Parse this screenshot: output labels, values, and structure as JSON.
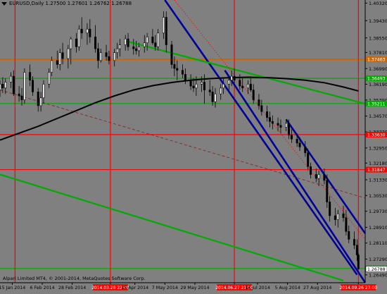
{
  "header": {
    "symbol": "EURUSD,Daily",
    "open": "1.27500",
    "high": "1.27601",
    "low": "1.26762",
    "close": "1.26788"
  },
  "footer": {
    "copyright": "Alpari Limited MT4, © 2001-2014, MetaQuotes Software Corp."
  },
  "colors": {
    "background": "#808080",
    "candle": "#000000",
    "moving_average": "#000000",
    "channel": "#000099",
    "green_lines": "#00aa00",
    "red_lines": "#ff0000",
    "orange_line": "#cc6600",
    "dashed_line": "#8b1a1a",
    "red_label": "#ff0000"
  },
  "chart_data": {
    "type": "candlestick",
    "symbol": "EURUSD",
    "timeframe": "Daily",
    "ylim": [
      1.2609,
      1.4048
    ],
    "y_ticks": [
      "1.40320",
      "1.39430",
      "1.38550",
      "1.37810",
      "1.36990",
      "1.36190",
      "1.35390",
      "1.34570",
      "1.33770",
      "1.32950",
      "1.32180",
      "1.31330",
      "1.30530",
      "1.29730",
      "1.28910",
      "1.28110",
      "1.27290",
      "1.26490"
    ],
    "x_ticks": [
      {
        "label": "15 Jan 2014",
        "date": "2014-01-15"
      },
      {
        "label": "6 Feb 2014",
        "date": "2014-02-06"
      },
      {
        "label": "28 Feb 2014",
        "date": "2014-02-28"
      },
      {
        "label": "2014.03.28 22:00",
        "date": "2014-03-28",
        "highlight": true
      },
      {
        "label": "15 Apr 2014",
        "date": "2014-04-15"
      },
      {
        "label": "7 May 2014",
        "date": "2014-05-07"
      },
      {
        "label": "29 May 2014",
        "date": "2014-05-29"
      },
      {
        "label": "2014.06.27 21:00",
        "date": "2014-06-27",
        "highlight": true
      },
      {
        "label": "14 Jul 2014",
        "date": "2014-07-14"
      },
      {
        "label": "5 Aug 2014",
        "date": "2014-08-05"
      },
      {
        "label": "27 Aug 2014",
        "date": "2014-08-27"
      },
      {
        "label": "2014.09.26 23:00",
        "date": "2014-09-26",
        "highlight": true
      }
    ],
    "price_levels": [
      {
        "label": "1.37463",
        "value": 1.37463,
        "color": "#cc6600"
      },
      {
        "label": "1.36493",
        "value": 1.36493,
        "color": "#00aa00"
      },
      {
        "label": "1.35211",
        "value": 1.35211,
        "color": "#00aa00"
      },
      {
        "label": "1.33630",
        "value": 1.3363,
        "color": "#ff0000"
      },
      {
        "label": "1.31847",
        "value": 1.31847,
        "color": "#ff0000"
      },
      {
        "label": "1.26815",
        "value": 1.26815,
        "color": "#00aa00"
      }
    ],
    "vertical_lines": [
      {
        "date": "2014-01-17",
        "color": "#ff0000"
      },
      {
        "date": "2014-03-28",
        "color": "#ff0000"
      },
      {
        "date": "2014-06-27",
        "color": "#ff0000"
      },
      {
        "date": "2014-09-26",
        "color": "#ff0000"
      }
    ],
    "trendlines": [
      {
        "kind": "channel",
        "color": "#000099",
        "points": [
          [
            "2014-05-07",
            1.4048
          ],
          [
            "2014-09-25",
            1.265
          ]
        ]
      },
      {
        "kind": "channel",
        "color": "#000099",
        "points": [
          [
            "2014-06-20",
            1.369
          ],
          [
            "2014-10-01",
            1.261
          ]
        ]
      },
      {
        "kind": "channel",
        "color": "#000099",
        "points": [
          [
            "2014-08-04",
            1.344
          ],
          [
            "2014-10-01",
            1.286
          ]
        ]
      },
      {
        "kind": "resistance",
        "color": "#00aa00",
        "points": [
          [
            "2014-04-08",
            1.384
          ],
          [
            "2014-10-01",
            1.352
          ]
        ]
      },
      {
        "kind": "support",
        "color": "#00aa00",
        "points": [
          [
            "2014-01-06",
            1.316
          ],
          [
            "2014-09-15",
            1.262
          ]
        ]
      },
      {
        "kind": "dashed",
        "color": "#8b1a1a",
        "points": [
          [
            "2014-01-06",
            1.359
          ],
          [
            "2014-10-01",
            1.304
          ]
        ]
      },
      {
        "kind": "dotted",
        "color": "#ff0000",
        "points": [
          [
            "2014-05-14",
            1.4048
          ],
          [
            "2014-10-01",
            1.283
          ]
        ]
      }
    ],
    "moving_average": [
      [
        "2014-01-06",
        1.3335
      ],
      [
        "2014-01-20",
        1.337
      ],
      [
        "2014-02-03",
        1.3405
      ],
      [
        "2014-02-17",
        1.3445
      ],
      [
        "2014-03-03",
        1.3485
      ],
      [
        "2014-03-17",
        1.3525
      ],
      [
        "2014-03-31",
        1.356
      ],
      [
        "2014-04-14",
        1.359
      ],
      [
        "2014-04-28",
        1.3612
      ],
      [
        "2014-05-12",
        1.3628
      ],
      [
        "2014-05-26",
        1.364
      ],
      [
        "2014-06-09",
        1.3648
      ],
      [
        "2014-06-23",
        1.3653
      ],
      [
        "2014-07-07",
        1.3655
      ],
      [
        "2014-07-21",
        1.3653
      ],
      [
        "2014-08-04",
        1.3648
      ],
      [
        "2014-08-18",
        1.364
      ],
      [
        "2014-09-01",
        1.3627
      ],
      [
        "2014-09-15",
        1.3605
      ],
      [
        "2014-09-26",
        1.3585
      ]
    ],
    "candles": [
      [
        "2014-01-06",
        1.359,
        1.364,
        1.3555,
        1.362
      ],
      [
        "2014-01-08",
        1.362,
        1.3655,
        1.3575,
        1.36
      ],
      [
        "2014-01-10",
        1.36,
        1.365,
        1.357,
        1.363
      ],
      [
        "2014-01-14",
        1.363,
        1.368,
        1.36,
        1.366
      ],
      [
        "2014-01-16",
        1.366,
        1.369,
        1.356,
        1.357
      ],
      [
        "2014-01-20",
        1.357,
        1.361,
        1.353,
        1.356
      ],
      [
        "2014-01-22",
        1.356,
        1.36,
        1.351,
        1.354
      ],
      [
        "2014-01-24",
        1.354,
        1.37,
        1.352,
        1.368
      ],
      [
        "2014-01-28",
        1.368,
        1.372,
        1.361,
        1.364
      ],
      [
        "2014-01-30",
        1.364,
        1.366,
        1.356,
        1.358
      ],
      [
        "2014-02-03",
        1.358,
        1.36,
        1.348,
        1.351
      ],
      [
        "2014-02-05",
        1.351,
        1.358,
        1.348,
        1.355
      ],
      [
        "2014-02-07",
        1.355,
        1.364,
        1.352,
        1.362
      ],
      [
        "2014-02-11",
        1.362,
        1.37,
        1.36,
        1.368
      ],
      [
        "2014-02-13",
        1.368,
        1.376,
        1.366,
        1.374
      ],
      [
        "2014-02-17",
        1.374,
        1.379,
        1.37,
        1.372
      ],
      [
        "2014-02-19",
        1.372,
        1.38,
        1.369,
        1.378
      ],
      [
        "2014-02-21",
        1.378,
        1.383,
        1.372,
        1.375
      ],
      [
        "2014-02-25",
        1.375,
        1.382,
        1.37,
        1.38
      ],
      [
        "2014-02-27",
        1.38,
        1.386,
        1.372,
        1.385
      ],
      [
        "2014-03-03",
        1.385,
        1.388,
        1.378,
        1.381
      ],
      [
        "2014-03-05",
        1.381,
        1.392,
        1.379,
        1.39
      ],
      [
        "2014-03-07",
        1.39,
        1.396,
        1.385,
        1.388
      ],
      [
        "2014-03-11",
        1.388,
        1.393,
        1.382,
        1.39
      ],
      [
        "2014-03-13",
        1.39,
        1.395,
        1.383,
        1.386
      ],
      [
        "2014-03-17",
        1.386,
        1.392,
        1.378,
        1.38
      ],
      [
        "2014-03-19",
        1.38,
        1.383,
        1.37,
        1.374
      ],
      [
        "2014-03-21",
        1.374,
        1.38,
        1.373,
        1.378
      ],
      [
        "2014-03-25",
        1.378,
        1.382,
        1.374,
        1.376
      ],
      [
        "2014-03-27",
        1.376,
        1.379,
        1.372,
        1.374
      ],
      [
        "2014-03-31",
        1.374,
        1.38,
        1.371,
        1.378
      ],
      [
        "2014-04-02",
        1.378,
        1.383,
        1.375,
        1.38
      ],
      [
        "2014-04-04",
        1.38,
        1.385,
        1.376,
        1.382
      ],
      [
        "2014-04-08",
        1.382,
        1.387,
        1.379,
        1.385
      ],
      [
        "2014-04-10",
        1.385,
        1.388,
        1.379,
        1.381
      ],
      [
        "2014-04-14",
        1.381,
        1.385,
        1.377,
        1.38
      ],
      [
        "2014-04-16",
        1.38,
        1.384,
        1.377,
        1.379
      ],
      [
        "2014-04-18",
        1.379,
        1.383,
        1.376,
        1.381
      ],
      [
        "2014-04-22",
        1.381,
        1.387,
        1.378,
        1.383
      ],
      [
        "2014-04-24",
        1.383,
        1.388,
        1.379,
        1.386
      ],
      [
        "2014-04-28",
        1.386,
        1.39,
        1.382,
        1.383
      ],
      [
        "2014-04-30",
        1.383,
        1.387,
        1.379,
        1.381
      ],
      [
        "2014-05-02",
        1.381,
        1.39,
        1.379,
        1.388
      ],
      [
        "2014-05-06",
        1.388,
        1.399,
        1.385,
        1.396
      ],
      [
        "2014-05-08",
        1.396,
        1.399,
        1.378,
        1.382
      ],
      [
        "2014-05-12",
        1.382,
        1.384,
        1.37,
        1.372
      ],
      [
        "2014-05-14",
        1.372,
        1.376,
        1.366,
        1.37
      ],
      [
        "2014-05-16",
        1.37,
        1.374,
        1.364,
        1.369
      ],
      [
        "2014-05-20",
        1.369,
        1.372,
        1.365,
        1.367
      ],
      [
        "2014-05-22",
        1.367,
        1.37,
        1.362,
        1.364
      ],
      [
        "2014-05-26",
        1.364,
        1.367,
        1.359,
        1.361
      ],
      [
        "2014-05-28",
        1.361,
        1.365,
        1.358,
        1.36
      ],
      [
        "2014-05-30",
        1.36,
        1.366,
        1.356,
        1.362
      ],
      [
        "2014-06-03",
        1.362,
        1.366,
        1.358,
        1.363
      ],
      [
        "2014-06-05",
        1.363,
        1.367,
        1.352,
        1.359
      ],
      [
        "2014-06-09",
        1.359,
        1.364,
        1.356,
        1.358
      ],
      [
        "2014-06-11",
        1.358,
        1.361,
        1.351,
        1.353
      ],
      [
        "2014-06-13",
        1.353,
        1.36,
        1.35,
        1.357
      ],
      [
        "2014-06-17",
        1.357,
        1.362,
        1.354,
        1.36
      ],
      [
        "2014-06-19",
        1.36,
        1.365,
        1.357,
        1.362
      ],
      [
        "2014-06-23",
        1.362,
        1.366,
        1.359,
        1.364
      ],
      [
        "2014-06-25",
        1.364,
        1.369,
        1.361,
        1.366
      ],
      [
        "2014-06-27",
        1.366,
        1.37,
        1.362,
        1.364
      ],
      [
        "2014-07-01",
        1.364,
        1.367,
        1.359,
        1.361
      ],
      [
        "2014-07-03",
        1.361,
        1.365,
        1.358,
        1.36
      ],
      [
        "2014-07-07",
        1.36,
        1.364,
        1.357,
        1.362
      ],
      [
        "2014-07-09",
        1.362,
        1.366,
        1.358,
        1.359
      ],
      [
        "2014-07-11",
        1.359,
        1.362,
        1.352,
        1.354
      ],
      [
        "2014-07-15",
        1.354,
        1.357,
        1.349,
        1.351
      ],
      [
        "2014-07-17",
        1.351,
        1.354,
        1.346,
        1.348
      ],
      [
        "2014-07-21",
        1.348,
        1.351,
        1.343,
        1.345
      ],
      [
        "2014-07-23",
        1.345,
        1.348,
        1.34,
        1.343
      ],
      [
        "2014-07-25",
        1.343,
        1.346,
        1.339,
        1.342
      ],
      [
        "2014-07-29",
        1.342,
        1.345,
        1.338,
        1.341
      ],
      [
        "2014-07-31",
        1.341,
        1.344,
        1.337,
        1.34
      ],
      [
        "2014-08-04",
        1.34,
        1.344,
        1.338,
        1.342
      ],
      [
        "2014-08-06",
        1.342,
        1.344,
        1.334,
        1.336
      ],
      [
        "2014-08-08",
        1.336,
        1.339,
        1.332,
        1.334
      ],
      [
        "2014-08-12",
        1.334,
        1.337,
        1.33,
        1.332
      ],
      [
        "2014-08-14",
        1.332,
        1.335,
        1.328,
        1.33
      ],
      [
        "2014-08-18",
        1.33,
        1.333,
        1.325,
        1.327
      ],
      [
        "2014-08-20",
        1.327,
        1.329,
        1.318,
        1.32
      ],
      [
        "2014-08-22",
        1.32,
        1.322,
        1.314,
        1.316
      ],
      [
        "2014-08-26",
        1.316,
        1.319,
        1.312,
        1.314
      ],
      [
        "2014-08-28",
        1.314,
        1.318,
        1.31,
        1.316
      ],
      [
        "2014-09-01",
        1.316,
        1.319,
        1.311,
        1.313
      ],
      [
        "2014-09-03",
        1.313,
        1.316,
        1.299,
        1.302
      ],
      [
        "2014-09-05",
        1.302,
        1.305,
        1.292,
        1.295
      ],
      [
        "2014-09-09",
        1.295,
        1.299,
        1.29,
        1.293
      ],
      [
        "2014-09-11",
        1.293,
        1.298,
        1.289,
        1.296
      ],
      [
        "2014-09-15",
        1.296,
        1.3,
        1.292,
        1.294
      ],
      [
        "2014-09-17",
        1.294,
        1.298,
        1.285,
        1.287
      ],
      [
        "2014-09-19",
        1.287,
        1.29,
        1.281,
        1.283
      ],
      [
        "2014-09-23",
        1.283,
        1.287,
        1.278,
        1.28
      ],
      [
        "2014-09-25",
        1.28,
        1.283,
        1.272,
        1.275
      ],
      [
        "2014-09-26",
        1.275,
        1.276,
        1.2676,
        1.2679
      ]
    ]
  }
}
